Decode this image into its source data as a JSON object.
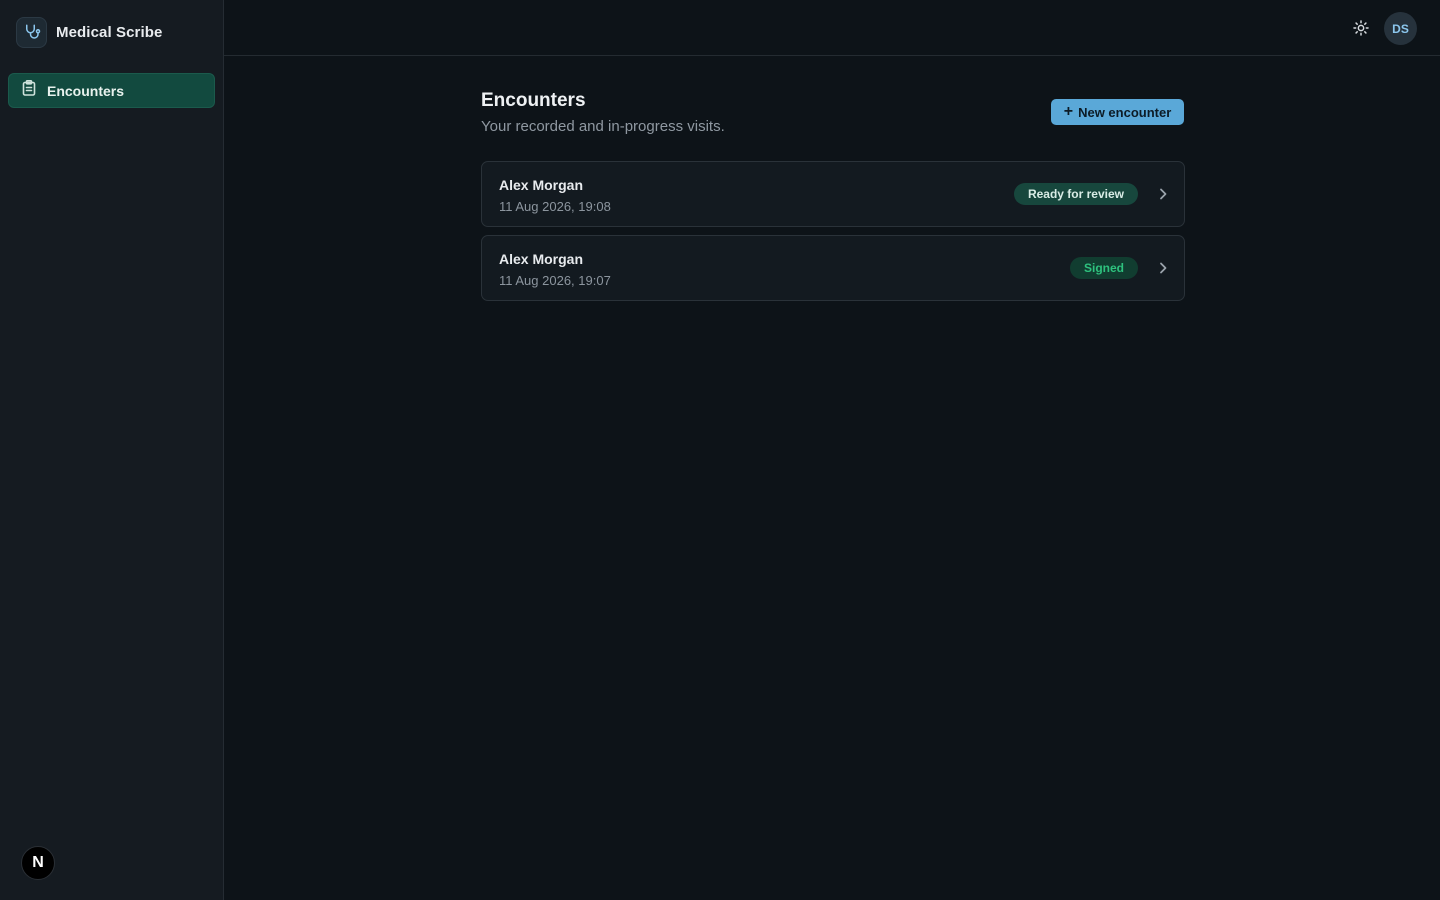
{
  "app": {
    "name": "Medical Scribe",
    "logo_icon": "stethoscope-icon"
  },
  "sidebar": {
    "items": [
      {
        "label": "Encounters",
        "icon": "clipboard-icon",
        "active": true
      }
    ],
    "footer_avatar": "N"
  },
  "header": {
    "theme_icon": "sun-icon",
    "user_initials": "DS"
  },
  "main": {
    "title": "Encounters",
    "subtitle": "Your recorded and in-progress visits.",
    "new_button": {
      "icon": "+",
      "label": "New encounter"
    },
    "encounters": [
      {
        "name": "Alex Morgan",
        "time": "11 Aug 2026, 19:08",
        "status": "Ready for review"
      },
      {
        "name": "Alex Morgan",
        "time": "11 Aug 2026, 19:07",
        "status": "Signed"
      }
    ]
  },
  "colors": {
    "background": "#0d1318",
    "sidebar": "#151b21",
    "active_nav": "#124a3f",
    "primary_button": "#5aa8d8",
    "badge_review": "#17473d",
    "badge_signed_text": "#2ec27e"
  }
}
